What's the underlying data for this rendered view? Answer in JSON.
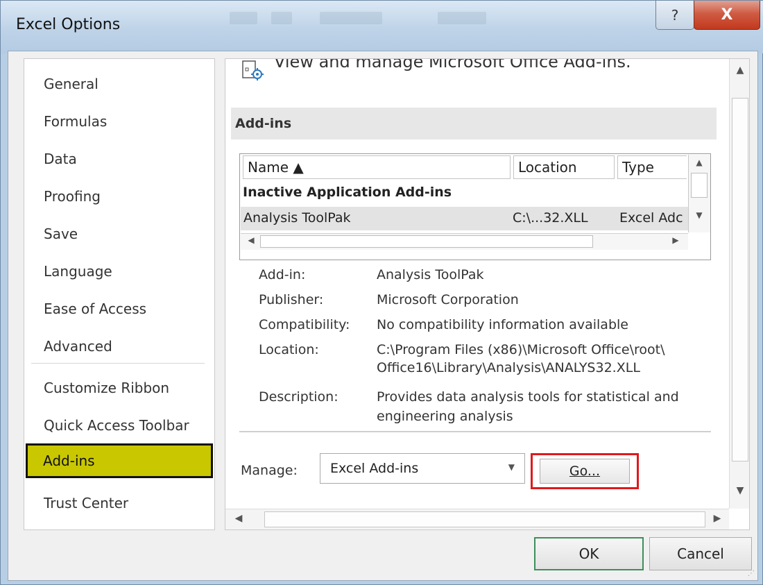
{
  "window": {
    "title": "Excel Options",
    "help_glyph": "?",
    "close_glyph": "X"
  },
  "nav": {
    "items": [
      {
        "label": "General"
      },
      {
        "label": "Formulas"
      },
      {
        "label": "Data"
      },
      {
        "label": "Proofing"
      },
      {
        "label": "Save"
      },
      {
        "label": "Language"
      },
      {
        "label": "Ease of Access"
      },
      {
        "label": "Advanced"
      },
      {
        "label": "Customize Ribbon"
      },
      {
        "label": "Quick Access Toolbar"
      },
      {
        "label": "Add-ins",
        "selected": true
      },
      {
        "label": "Trust Center"
      }
    ]
  },
  "main": {
    "header_text": "View and manage Microsoft Office Add-ins.",
    "section_title": "Add-ins",
    "list": {
      "columns": [
        "Name ▲",
        "Location",
        "Type"
      ],
      "group": "Inactive Application Add-ins",
      "rows": [
        {
          "name": "Analysis ToolPak",
          "location": "C:\\...32.XLL",
          "type": "Excel Adc"
        }
      ]
    },
    "details": {
      "addin_label": "Add-in:",
      "addin_value": "Analysis ToolPak",
      "publisher_label": "Publisher:",
      "publisher_value": "Microsoft Corporation",
      "compat_label": "Compatibility:",
      "compat_value": "No compatibility information available",
      "location_label": "Location:",
      "location_value_1": "C:\\Program Files (x86)\\Microsoft Office\\root\\",
      "location_value_2": "Office16\\Library\\Analysis\\ANALYS32.XLL",
      "description_label": "Description:",
      "description_value_1": "Provides data analysis tools for statistical and",
      "description_value_2": "engineering analysis"
    },
    "manage": {
      "label": "Manage:",
      "selected": "Excel Add-ins",
      "go_label": "Go..."
    }
  },
  "footer": {
    "ok_label": "OK",
    "cancel_label": "Cancel"
  },
  "colors": {
    "selected_nav_bg": "#c9c700",
    "go_highlight": "#e0191c",
    "ok_border": "#3c8f5a",
    "close_button": "#c2391d"
  }
}
